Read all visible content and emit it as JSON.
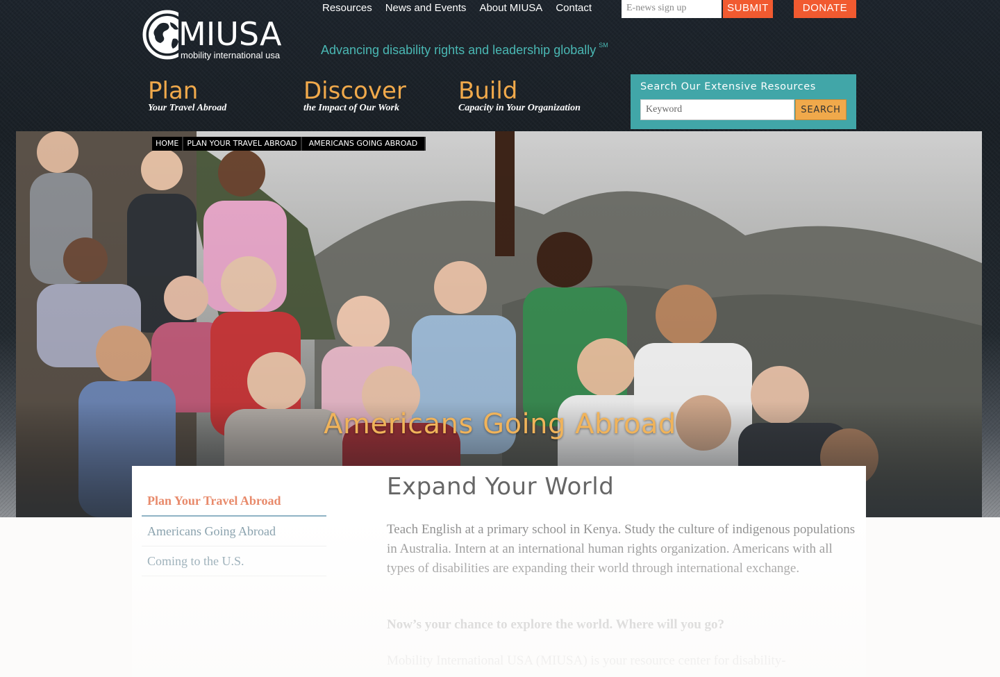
{
  "header": {
    "logo_text": "MIUSA",
    "logo_subtext": "mobility international usa",
    "tagline": "Advancing disability rights and leadership globally",
    "tagline_mark": "SM",
    "nav": [
      "Resources",
      "News and Events",
      "About MIUSA",
      "Contact"
    ],
    "enews_placeholder": "E-news sign up",
    "submit_label": "SUBMIT",
    "donate_label": "DONATE",
    "pillars": [
      {
        "title": "Plan",
        "subtitle": "Your Travel Abroad"
      },
      {
        "title": "Discover",
        "subtitle": "the Impact of Our Work"
      },
      {
        "title": "Build",
        "subtitle": "Capacity in Your Organization"
      }
    ],
    "search": {
      "label": "Search Our Extensive Resources",
      "placeholder": "Keyword",
      "button": "SEARCH"
    },
    "colors": {
      "accent_orange": "#f15a30",
      "teal": "#41a6a8",
      "gold": "#f0a94b"
    }
  },
  "hero": {
    "breadcrumb": [
      "HOME",
      "PLAN YOUR TRAVEL ABROAD",
      "AMERICANS GOING ABROAD"
    ],
    "title": "Americans Going Abroad"
  },
  "sidebar": {
    "items": [
      {
        "label": "Plan Your Travel Abroad",
        "active": true
      },
      {
        "label": "Americans Going Abroad",
        "active": false
      },
      {
        "label": "Coming to the U.S.",
        "active": false
      }
    ]
  },
  "main": {
    "title": "Expand Your World",
    "paragraphs": [
      "Teach English at a primary school in Kenya. Study the culture of indigenous populations in Australia. Intern at an international human rights organization. Americans with all types of disabilities are expanding their world through international exchange.",
      "Now’s your chance to explore the world. Where will you go?",
      "Mobility International USA (MIUSA) is your resource center for disability-"
    ]
  }
}
